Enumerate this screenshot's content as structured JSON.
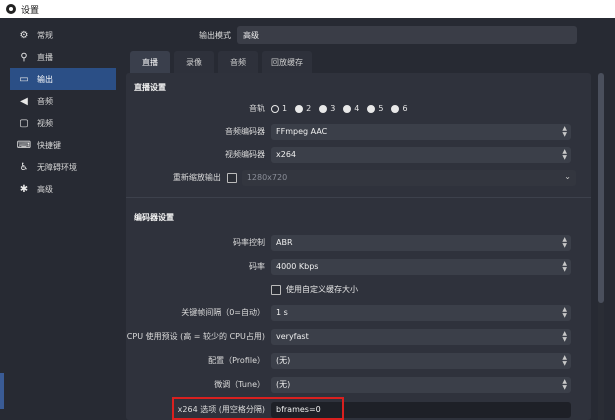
{
  "window": {
    "title": "设置"
  },
  "sidebar": {
    "items": [
      {
        "label": "常规",
        "icon": "gear-icon",
        "glyph": "⚙",
        "active": false
      },
      {
        "label": "直播",
        "icon": "antenna-icon",
        "glyph": "⚲",
        "active": false
      },
      {
        "label": "输出",
        "icon": "output-icon",
        "glyph": "▭",
        "active": true
      },
      {
        "label": "音频",
        "icon": "speaker-icon",
        "glyph": "◀",
        "active": false
      },
      {
        "label": "视频",
        "icon": "monitor-icon",
        "glyph": "▢",
        "active": false
      },
      {
        "label": "快捷键",
        "icon": "keyboard-icon",
        "glyph": "⌨",
        "active": false
      },
      {
        "label": "无障碍环境",
        "icon": "accessibility-icon",
        "glyph": "♿",
        "active": false
      },
      {
        "label": "高级",
        "icon": "tools-icon",
        "glyph": "✱",
        "active": false
      }
    ]
  },
  "output_mode": {
    "label": "输出模式",
    "value": "高级"
  },
  "tabs": [
    {
      "label": "直播",
      "active": true
    },
    {
      "label": "录像",
      "active": false
    },
    {
      "label": "音频",
      "active": false
    },
    {
      "label": "回放缓存",
      "active": false
    }
  ],
  "live_settings": {
    "title": "直播设置",
    "audio_track": {
      "label": "音轨",
      "tracks": [
        "1",
        "2",
        "3",
        "4",
        "5",
        "6"
      ],
      "selected": "1"
    },
    "audio_encoder": {
      "label": "音频编码器",
      "value": "FFmpeg AAC"
    },
    "video_encoder": {
      "label": "视频编码器",
      "value": "x264"
    },
    "rescale_output": {
      "label": "重新缩放输出",
      "value": "1280x720"
    }
  },
  "encoder_settings": {
    "title": "编码器设置",
    "rate_control": {
      "label": "码率控制",
      "value": "ABR"
    },
    "bitrate": {
      "label": "码率",
      "value": "4000 Kbps"
    },
    "custom_buffer": {
      "label": "使用自定义缓存大小"
    },
    "keyframe_interval": {
      "label": "关键帧间隔（0=自动）",
      "value": "1 s"
    },
    "cpu_preset": {
      "label": "CPU 使用预设 (高 = 较少的 CPU占用)",
      "value": "veryfast"
    },
    "profile": {
      "label": "配置（Profile）",
      "value": "(无)"
    },
    "tune": {
      "label": "微调（Tune）",
      "value": "(无)"
    },
    "x264_options": {
      "label": "x264 选项 (用空格分隔)",
      "value": "bframes=0"
    }
  },
  "colors": {
    "accent": "#2b4f86",
    "highlight_border": "#d9201f",
    "background": "#272a33"
  }
}
